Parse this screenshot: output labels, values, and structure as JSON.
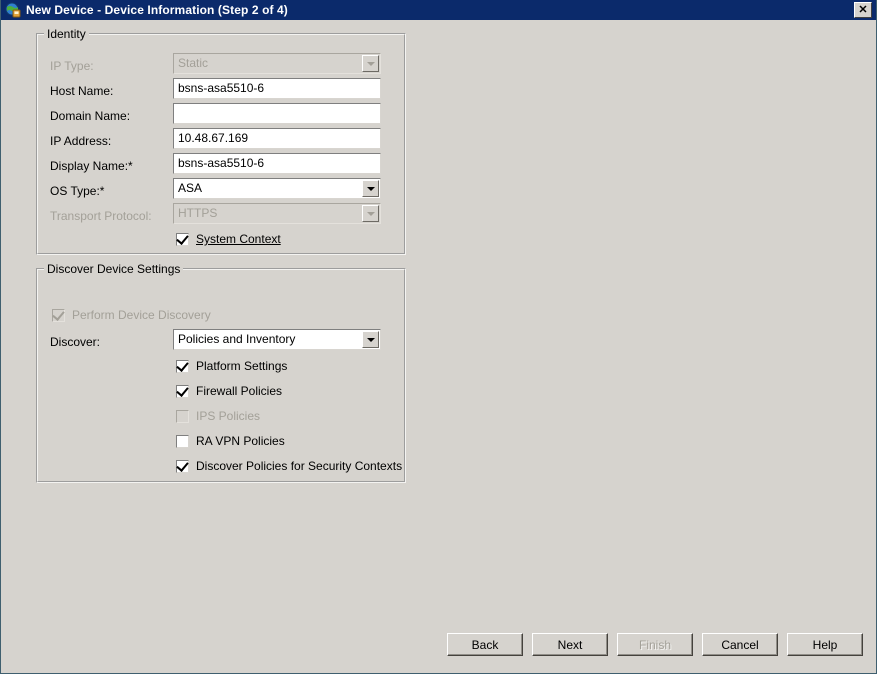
{
  "window": {
    "title": "New Device - Device Information (Step 2 of 4)",
    "icon": "globe-device-icon",
    "close_label": "✕",
    "titlebar_color": "#0b2a6b",
    "face_color": "#d6d3ce"
  },
  "identity": {
    "group_title": "Identity",
    "ip_type": {
      "label": "IP Type:",
      "value": "Static",
      "enabled": false
    },
    "host_name": {
      "label": "Host Name:",
      "value": "bsns-asa5510-6",
      "placeholder": "",
      "enabled": true
    },
    "domain_name": {
      "label": "Domain Name:",
      "value": "",
      "placeholder": "",
      "enabled": true
    },
    "ip_address": {
      "label": "IP Address:",
      "value": "10.48.67.169",
      "placeholder": "",
      "enabled": true
    },
    "display_name": {
      "label": "Display Name:*",
      "value": "bsns-asa5510-6",
      "placeholder": "",
      "enabled": true
    },
    "os_type": {
      "label": "OS Type:*",
      "value": "ASA",
      "enabled": true
    },
    "transport_protocol": {
      "label": "Transport Protocol:",
      "value": "HTTPS",
      "enabled": false
    },
    "system_context": {
      "label": "System Context",
      "checked": true,
      "enabled": true
    }
  },
  "discover": {
    "group_title": "Discover Device Settings",
    "perform_device_discovery": {
      "label": "Perform Device Discovery",
      "checked": true,
      "enabled": false
    },
    "discover_select": {
      "label": "Discover:",
      "value": "Policies and Inventory",
      "enabled": true
    },
    "options": [
      {
        "label": "Platform Settings",
        "checked": true,
        "enabled": true
      },
      {
        "label": "Firewall Policies",
        "checked": true,
        "enabled": true
      },
      {
        "label": "IPS Policies",
        "checked": false,
        "enabled": false
      },
      {
        "label": "RA VPN Policies",
        "checked": false,
        "enabled": true
      },
      {
        "label": "Discover Policies for Security Contexts",
        "checked": true,
        "enabled": true
      }
    ]
  },
  "buttons": {
    "back": {
      "label": "Back",
      "enabled": true
    },
    "next": {
      "label": "Next",
      "enabled": true
    },
    "finish": {
      "label": "Finish",
      "enabled": false
    },
    "cancel": {
      "label": "Cancel",
      "enabled": true
    },
    "help": {
      "label": "Help",
      "enabled": true
    }
  }
}
